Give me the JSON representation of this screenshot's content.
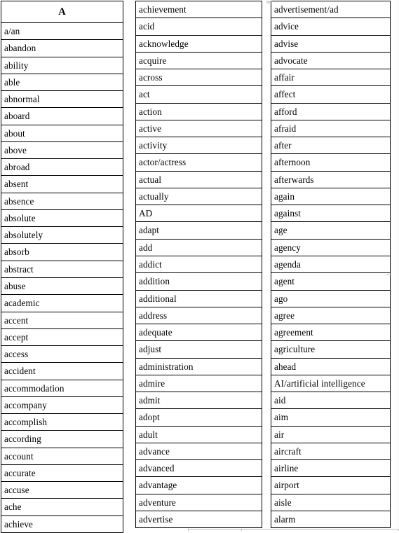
{
  "document": {
    "title": "Vocabulary Word List — Letter A",
    "letter_heading": "A",
    "background_color": "#ffffff",
    "text_color": "#000000",
    "border_color": "#000000"
  },
  "columns": [
    {
      "id": "col-1",
      "has_header": true,
      "header": "A",
      "words": [
        "a/an",
        "abandon",
        "ability",
        "able",
        "abnormal",
        "aboard",
        "about",
        "above",
        "abroad",
        "absent",
        "absence",
        "absolute",
        "absolutely",
        "absorb",
        "abstract",
        "abuse",
        "academic",
        "accent",
        "accept",
        "access",
        "accident",
        "accommodation",
        "accompany",
        "accomplish",
        "according",
        "account",
        "accurate",
        "accuse",
        "ache",
        "achieve"
      ]
    },
    {
      "id": "col-2",
      "has_header": false,
      "header": "",
      "words": [
        "achievement",
        "acid",
        "acknowledge",
        "acquire",
        "across",
        "act",
        "action",
        "active",
        "activity",
        "actor/actress",
        "actual",
        "actually",
        "AD",
        "adapt",
        "add",
        "addict",
        "addition",
        "additional",
        "address",
        "adequate",
        "adjust",
        "administration",
        "admire",
        "admit",
        "adopt",
        "adult",
        "advance",
        "advanced",
        "advantage",
        "adventure",
        "advertise"
      ]
    },
    {
      "id": "col-3",
      "has_header": false,
      "header": "",
      "words": [
        "advertisement/ad",
        "advice",
        "advise",
        "advocate",
        "affair",
        "affect",
        "afford",
        "afraid",
        "after",
        "afternoon",
        "afterwards",
        "again",
        "against",
        "age",
        "agency",
        "agenda",
        "agent",
        "ago",
        "agree",
        "agreement",
        "agriculture",
        "ahead",
        "AI/artificial intelligence",
        "aid",
        "aim",
        "air",
        "aircraft",
        "airline",
        "airport",
        "aisle",
        "alarm"
      ]
    }
  ]
}
